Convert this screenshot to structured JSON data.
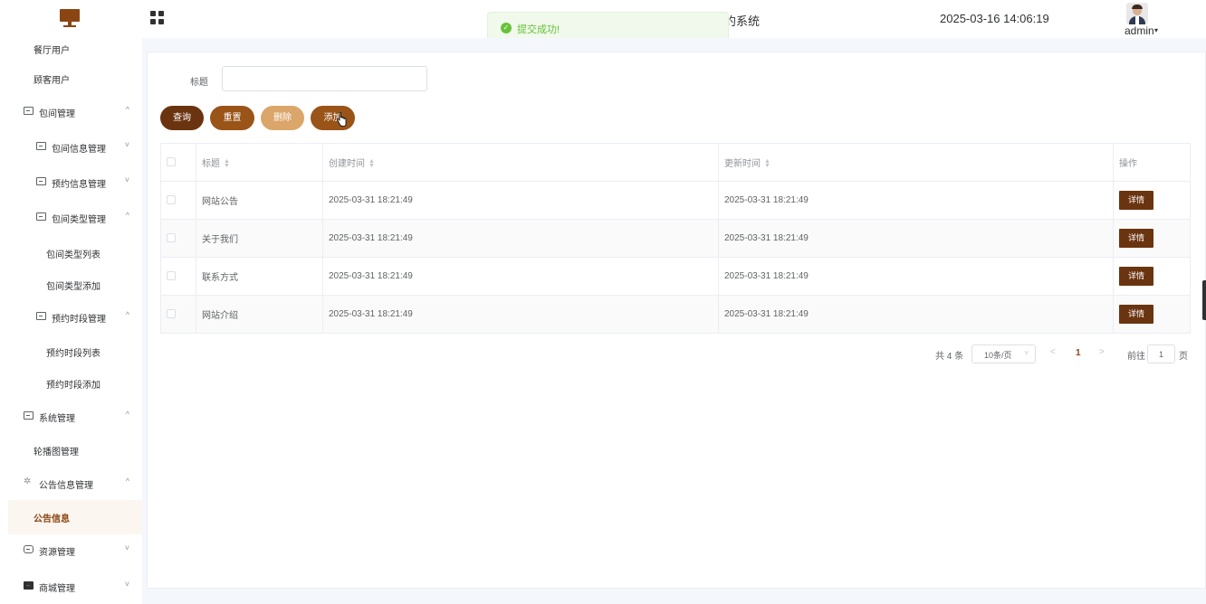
{
  "header": {
    "system_title": "约系统",
    "datetime": "2025-03-16 14:06:19",
    "user": "admin"
  },
  "toast": {
    "message": "提交成功!",
    "icon": "check-circle-icon"
  },
  "colors": {
    "accent": "#8b4513",
    "button_dark": "#6b3410",
    "button_mid": "#9a5418",
    "button_disabled": "#dba66a",
    "toast": "#67c23a"
  },
  "sidebar": {
    "items": [
      {
        "label": "餐厅用户"
      },
      {
        "label": "顾客用户"
      },
      {
        "label": "包间管理",
        "icon": "card-icon",
        "arrow": "^"
      },
      {
        "label": "包间信息管理",
        "icon": "card-icon",
        "arrow": "˅"
      },
      {
        "label": "预约信息管理",
        "icon": "card-icon",
        "arrow": "˅"
      },
      {
        "label": "包间类型管理",
        "icon": "card-icon",
        "arrow": "^"
      },
      {
        "label": "包间类型列表"
      },
      {
        "label": "包间类型添加"
      },
      {
        "label": "预约时段管理",
        "icon": "card-icon",
        "arrow": "^"
      },
      {
        "label": "预约时段列表"
      },
      {
        "label": "预约时段添加"
      },
      {
        "label": "系统管理",
        "icon": "folder-icon",
        "arrow": "^"
      },
      {
        "label": "轮播图管理"
      },
      {
        "label": "公告信息管理",
        "icon": "sun-icon",
        "arrow": "^"
      },
      {
        "label": "公告信息",
        "active": true
      },
      {
        "label": "资源管理",
        "icon": "box-icon",
        "arrow": "˅"
      },
      {
        "label": "商城管理",
        "icon": "monitor-icon",
        "arrow": "˅"
      }
    ]
  },
  "search": {
    "label": "标题",
    "value": "",
    "placeholder": ""
  },
  "actions": {
    "query": "查询",
    "reset": "重置",
    "delete": "删除",
    "add": "添加"
  },
  "table": {
    "columns": {
      "title": "标题",
      "created": "创建时间",
      "updated": "更新时间",
      "operation": "操作"
    },
    "rows": [
      {
        "title": "网站公告",
        "created": "2025-03-31 18:21:49",
        "updated": "2025-03-31 18:21:49",
        "action": "详情"
      },
      {
        "title": "关于我们",
        "created": "2025-03-31 18:21:49",
        "updated": "2025-03-31 18:21:49",
        "action": "详情"
      },
      {
        "title": "联系方式",
        "created": "2025-03-31 18:21:49",
        "updated": "2025-03-31 18:21:49",
        "action": "详情"
      },
      {
        "title": "网站介绍",
        "created": "2025-03-31 18:21:49",
        "updated": "2025-03-31 18:21:49",
        "action": "详情"
      }
    ]
  },
  "pagination": {
    "total": "共 4 条",
    "page_size": "10条/页",
    "current": "1",
    "goto_label": "前往",
    "goto_value": "1",
    "page_suffix": "页"
  }
}
